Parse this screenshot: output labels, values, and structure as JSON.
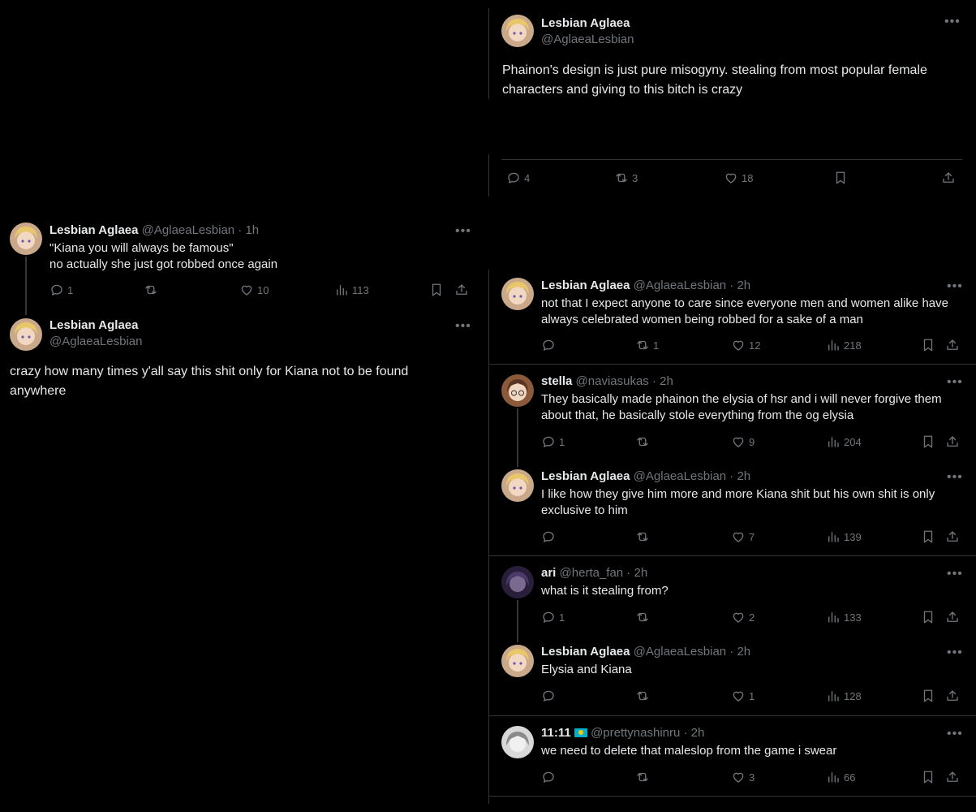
{
  "top_post": {
    "name": "Lesbian Aglaea",
    "handle": "@AglaeaLesbian",
    "text": "Phainon's design is just pure misogyny. stealing from most popular female characters and giving to this bitch is crazy",
    "replies": "4",
    "reposts": "3",
    "likes": "18"
  },
  "left_reply": {
    "name": "Lesbian Aglaea",
    "handle_time": "@AglaeaLesbian · 1h",
    "line1": "\"Kiana you will always be famous\"",
    "line2": "no actually she just got robbed once again",
    "replies": "1",
    "reposts": "",
    "likes": "10",
    "views": "113"
  },
  "left_post": {
    "name": "Lesbian Aglaea",
    "handle": "@AglaeaLesbian",
    "text": "crazy how many times y'all say this shit only for Kiana not to be found anywhere"
  },
  "replies": [
    {
      "name": "Lesbian Aglaea",
      "handle_time": "@AglaeaLesbian · 2h",
      "text": "not that I expect anyone to care since everyone men and women alike have always celebrated women being robbed for a sake of a man",
      "replies": "",
      "reposts": "1",
      "likes": "12",
      "views": "218"
    },
    {
      "name": "stella",
      "handle_time": "@naviasukas · 2h",
      "text": "They basically made phainon the elysia of hsr and i will never forgive them about that, he basically stole everything from the og elysia",
      "replies": "1",
      "reposts": "",
      "likes": "9",
      "views": "204"
    },
    {
      "name": "Lesbian Aglaea",
      "handle_time": "@AglaeaLesbian · 2h",
      "text": "I like how they give him more and more Kiana shit but his own shit is only exclusive to him",
      "replies": "",
      "reposts": "",
      "likes": "7",
      "views": "139"
    },
    {
      "name": "ari",
      "handle_time": "@herta_fan · 2h",
      "text": "what is it stealing from?",
      "replies": "1",
      "reposts": "",
      "likes": "2",
      "views": "133"
    },
    {
      "name": "Lesbian Aglaea",
      "handle_time": "@AglaeaLesbian · 2h",
      "text": "Elysia and Kiana",
      "replies": "",
      "reposts": "",
      "likes": "1",
      "views": "128"
    },
    {
      "name": "11:11",
      "handle_time": "@prettynashinru · 2h",
      "text": "we need to delete that maleslop from the game i swear",
      "replies": "",
      "reposts": "",
      "likes": "3",
      "views": "66"
    }
  ],
  "icons": {
    "reply": "reply-bubble-icon",
    "repost": "repost-arrows-icon",
    "like": "heart-icon",
    "views": "bar-chart-icon",
    "bookmark": "bookmark-icon",
    "share": "share-upload-icon",
    "more": "more-dots-icon",
    "flag": "kazakhstan-flag-icon"
  },
  "colors": {
    "background": "#000000",
    "text": "#e7e9ea",
    "muted": "#71767b",
    "divider": "#2f3336"
  }
}
